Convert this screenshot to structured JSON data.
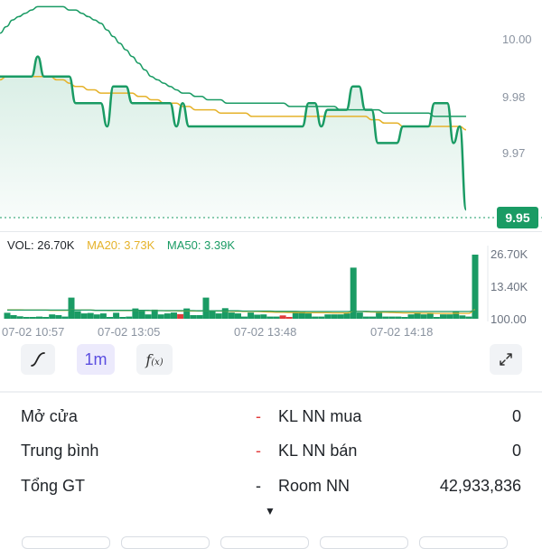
{
  "price_axis": {
    "labels": [
      "10.00",
      "9.98",
      "9.97"
    ]
  },
  "last_price": "9.95",
  "volume_legend": {
    "vol": "VOL: 26.70K",
    "ma20": "MA20: 3.73K",
    "ma50": "MA50: 3.39K"
  },
  "volume_axis": {
    "labels": [
      "26.70K",
      "13.40K",
      "100.00"
    ]
  },
  "time_labels": [
    "07-02 10:57",
    "07-02 13:05",
    "07-02 13:48",
    "07-02 14:18"
  ],
  "toolbar": {
    "chart_type_icon": "line-curve-icon",
    "interval": "1m",
    "indicator_icon": "function-icon",
    "fullscreen_icon": "expand-icon"
  },
  "info": [
    {
      "label": "Mở cửa",
      "value": "-",
      "label2": "KL NN mua",
      "value2": "0"
    },
    {
      "label": "Trung bình",
      "value": "-",
      "label2": "KL NN bán",
      "value2": "0"
    },
    {
      "label": "Tổng GT",
      "value": "-",
      "label2": "Room NN",
      "value2": "42,933,836"
    }
  ],
  "colors": {
    "price_line": "#1a9b64",
    "ma_yellow": "#e5b22a",
    "ma_green": "#1a9b64",
    "vol_up": "#1a9b64",
    "vol_down": "#e23b3b",
    "dash_red": "#e23b3b"
  },
  "chart_data": [
    {
      "type": "line",
      "title": "",
      "xlabel": "",
      "ylabel": "",
      "ylim": [
        9.9435,
        10.013
      ],
      "y_ticks": [
        10.0,
        9.98,
        9.97
      ],
      "series": [
        {
          "values": [
            9.99,
            9.99,
            9.99,
            9.99,
            9.99,
            9.99,
            9.996,
            9.99,
            9.99,
            9.99,
            9.99,
            9.99,
            9.982,
            9.982,
            9.982,
            9.982,
            9.982,
            9.975,
            9.987,
            9.987,
            9.987,
            9.982,
            9.982,
            9.982,
            9.982,
            9.982,
            9.982,
            9.982,
            9.975,
            9.982,
            9.975,
            9.975,
            9.975,
            9.975,
            9.975,
            9.975,
            9.975,
            9.975,
            9.975,
            9.975,
            9.975,
            9.975,
            9.975,
            9.975,
            9.975,
            9.975,
            9.975,
            9.975,
            9.975,
            9.982,
            9.982,
            9.975,
            9.98,
            9.98,
            9.98,
            9.98,
            9.987,
            9.987,
            9.98,
            9.98,
            9.97,
            9.97,
            9.97,
            9.97,
            9.975,
            9.975,
            9.975,
            9.975,
            9.975,
            9.982,
            9.982,
            9.982,
            9.97,
            9.975,
            9.95
          ]
        },
        {
          "values": [
            9.989,
            9.99,
            9.99,
            9.99,
            9.99,
            9.99,
            9.99,
            9.99,
            9.99,
            9.989,
            9.989,
            9.988,
            9.987,
            9.987,
            9.986,
            9.986,
            9.985,
            9.985,
            9.985,
            9.985,
            9.985,
            9.985,
            9.984,
            9.984,
            9.983,
            9.983,
            9.982,
            9.982,
            9.982,
            9.981,
            9.981,
            9.98,
            9.98,
            9.98,
            9.98,
            9.979,
            9.979,
            9.979,
            9.979,
            9.979,
            9.978,
            9.978,
            9.978,
            9.978,
            9.978,
            9.978,
            9.978,
            9.978,
            9.978,
            9.978,
            9.978,
            9.978,
            9.978,
            9.978,
            9.978,
            9.978,
            9.978,
            9.978,
            9.978,
            9.977,
            9.977,
            9.976,
            9.976,
            9.976,
            9.975,
            9.975,
            9.975,
            9.975,
            9.975,
            9.975,
            9.975,
            9.975,
            9.975,
            9.975,
            9.974
          ]
        },
        {
          "values": [
            10.003,
            10.005,
            10.007,
            10.008,
            10.009,
            10.01,
            10.011,
            10.011,
            10.011,
            10.011,
            10.011,
            10.01,
            10.01,
            10.009,
            10.008,
            10.007,
            10.006,
            10.004,
            10.002,
            10.0,
            9.998,
            9.996,
            9.994,
            9.992,
            9.99,
            9.989,
            9.988,
            9.987,
            9.986,
            9.985,
            9.985,
            9.984,
            9.984,
            9.983,
            9.983,
            9.983,
            9.982,
            9.982,
            9.982,
            9.982,
            9.982,
            9.982,
            9.982,
            9.982,
            9.982,
            9.982,
            9.981,
            9.981,
            9.981,
            9.981,
            9.981,
            9.981,
            9.981,
            9.981,
            9.98,
            9.98,
            9.98,
            9.98,
            9.98,
            9.98,
            9.98,
            9.979,
            9.979,
            9.979,
            9.979,
            9.979,
            9.979,
            9.979,
            9.979,
            9.978,
            9.978,
            9.978,
            9.978,
            9.978,
            9.978
          ]
        }
      ]
    },
    {
      "type": "bar",
      "title": "",
      "ylim": [
        0,
        26700
      ],
      "y_ticks": [
        "26.70K",
        "13.40K",
        "100.00"
      ],
      "values": [
        2500,
        1500,
        1000,
        600,
        400,
        900,
        600,
        1800,
        1500,
        900,
        8800,
        3200,
        2200,
        2400,
        1800,
        2200,
        400,
        2500,
        700,
        900,
        4300,
        3200,
        1800,
        3800,
        1800,
        2200,
        2600,
        1900,
        4300,
        1500,
        1500,
        8800,
        3200,
        2200,
        4400,
        2600,
        2200,
        900,
        2600,
        1700,
        1800,
        900,
        900,
        1400,
        400,
        2500,
        2900,
        2200,
        900,
        900,
        1800,
        1800,
        1800,
        2200,
        21300,
        2600,
        900,
        900,
        2500,
        900,
        900,
        900,
        700,
        1800,
        2600,
        1800,
        2100,
        700,
        1800,
        1800,
        3200,
        1400,
        900,
        26700
      ],
      "down_indices": [
        27,
        43,
        44
      ],
      "ma_series": [
        {
          "values": [
            3700,
            3700,
            3700,
            3600,
            3600,
            3600,
            3600,
            3500,
            3500,
            3500,
            3600,
            3600,
            3600,
            3600,
            3500,
            3500,
            3400,
            3400,
            3400,
            3400,
            3500,
            3500,
            3400,
            3400,
            3400,
            3300,
            3300,
            3200,
            3300,
            3200,
            3200,
            3300,
            3300,
            3200,
            3200,
            3100,
            3100,
            3000,
            3000,
            3000,
            2900,
            2800,
            2700,
            2700,
            2600,
            2600,
            2600,
            2500,
            2500,
            2500,
            2500,
            2400,
            2400,
            2400,
            3100,
            3000,
            2900,
            2800,
            2700,
            2700,
            2600,
            2500,
            2400,
            2400,
            2400,
            2300,
            2300,
            2200,
            2200,
            2200,
            2300,
            2200,
            2200,
            3730
          ]
        },
        {
          "values": [
            3600,
            3600,
            3600,
            3600,
            3600,
            3600,
            3600,
            3600,
            3600,
            3600,
            3600,
            3600,
            3600,
            3600,
            3500,
            3500,
            3500,
            3500,
            3500,
            3500,
            3500,
            3500,
            3500,
            3400,
            3400,
            3400,
            3400,
            3400,
            3400,
            3400,
            3300,
            3300,
            3300,
            3300,
            3300,
            3300,
            3300,
            3200,
            3200,
            3200,
            3200,
            3200,
            3100,
            3100,
            3100,
            3100,
            3000,
            3000,
            3000,
            3000,
            3000,
            3000,
            3000,
            3000,
            3100,
            3100,
            3100,
            3000,
            3000,
            3000,
            3000,
            3000,
            3000,
            3000,
            3000,
            3000,
            3000,
            3000,
            3000,
            3000,
            3000,
            3000,
            3000,
            3390
          ]
        }
      ]
    }
  ]
}
